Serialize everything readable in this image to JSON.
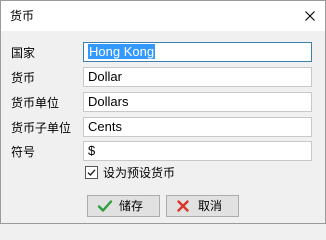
{
  "window": {
    "title": "货币"
  },
  "form": {
    "country_label": "国家",
    "country_value": "Hong Kong",
    "currency_label": "货币",
    "currency_value": "Dollar",
    "unit_label": "货币单位",
    "unit_value": "Dollars",
    "subunit_label": "货币子单位",
    "subunit_value": "Cents",
    "symbol_label": "符号",
    "symbol_value": "$",
    "default_checkbox_label": "设为预设货币",
    "default_checked": true
  },
  "buttons": {
    "save_label": "储存",
    "cancel_label": "取消"
  },
  "colors": {
    "save_icon": "#2e9e3f",
    "cancel_icon": "#d9342b",
    "selection": "#3399ff",
    "focus_border": "#3c7fb1"
  },
  "icons": {
    "close": "close-icon",
    "save": "checkmark-icon",
    "cancel": "x-icon",
    "checkbox": "checkmark-icon"
  }
}
